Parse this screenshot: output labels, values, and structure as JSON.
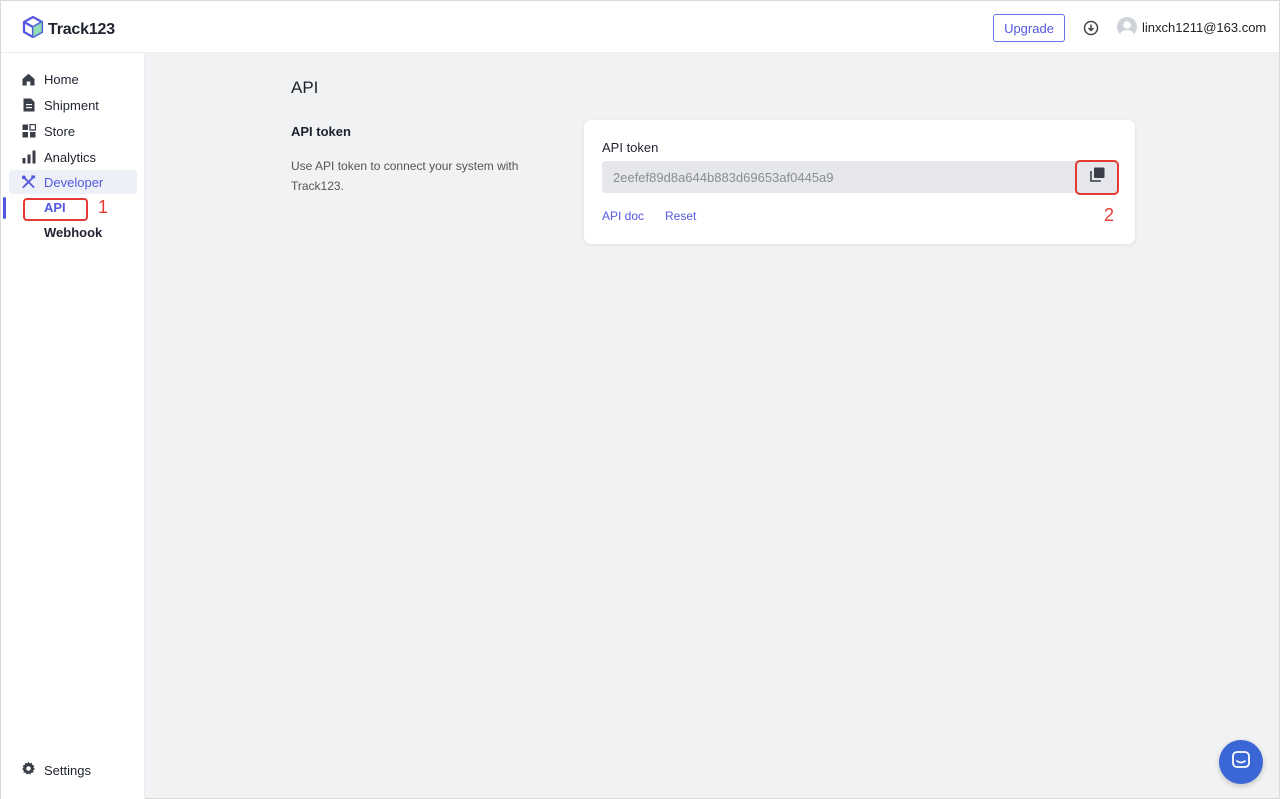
{
  "header": {
    "brand": "Track123",
    "upgrade_label": "Upgrade",
    "user_email": "linxch1211@163.com"
  },
  "sidebar": {
    "items": [
      {
        "label": "Home",
        "icon": "home-icon"
      },
      {
        "label": "Shipment",
        "icon": "document-icon"
      },
      {
        "label": "Store",
        "icon": "grid-icon"
      },
      {
        "label": "Analytics",
        "icon": "bar-chart-icon"
      },
      {
        "label": "Developer",
        "icon": "tools-icon",
        "active": true
      }
    ],
    "sub_items": [
      {
        "label": "API",
        "active": true
      },
      {
        "label": "Webhook"
      }
    ],
    "settings_label": "Settings"
  },
  "main": {
    "page_title": "API",
    "section_title": "API token",
    "section_description": "Use API token to connect your system with Track123.",
    "card": {
      "label": "API token",
      "token_value": "2eefef89d8a644b883d69653af0445a9",
      "api_doc_link": "API doc",
      "reset_link": "Reset"
    }
  },
  "annotations": [
    "1",
    "2"
  ],
  "colors": {
    "accent": "#5458e0",
    "annotation": "#e53935",
    "chat_button": "#3b66d6"
  }
}
